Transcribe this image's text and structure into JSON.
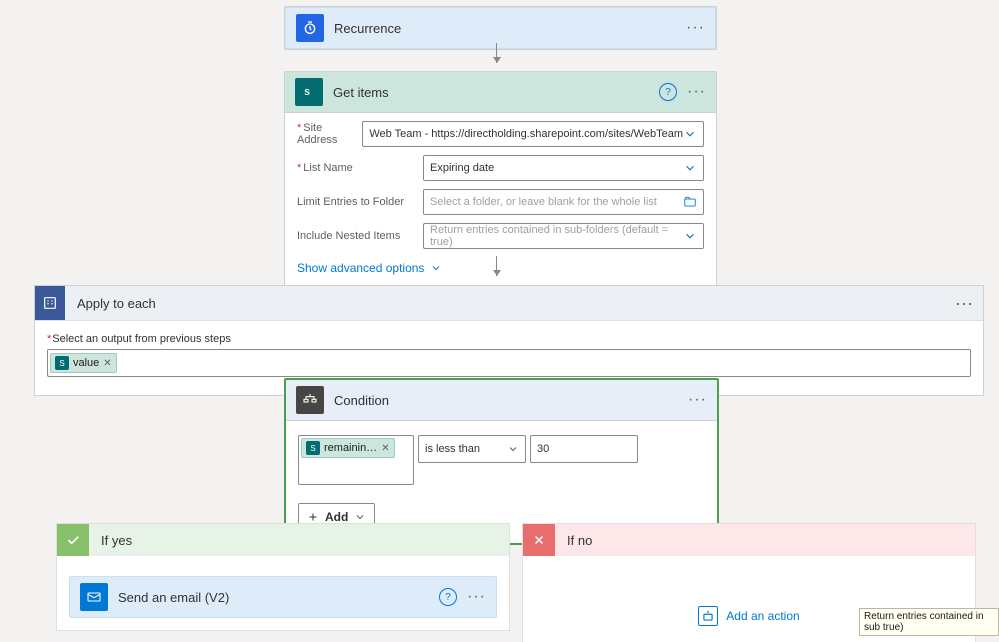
{
  "recurrence": {
    "title": "Recurrence"
  },
  "getItems": {
    "title": "Get items",
    "siteAddress": {
      "label": "Site Address",
      "value": "Web Team - https://directholding.sharepoint.com/sites/WebTeam"
    },
    "listName": {
      "label": "List Name",
      "value": "Expiring date"
    },
    "limitFolder": {
      "label": "Limit Entries to Folder",
      "placeholder": "Select a folder, or leave blank for the whole list"
    },
    "nested": {
      "label": "Include Nested Items",
      "placeholder": "Return entries contained in sub-folders (default = true)"
    },
    "advanced": "Show advanced options"
  },
  "applyToEach": {
    "title": "Apply to each",
    "outputLabel": "Select an output from previous steps",
    "token": "value"
  },
  "condition": {
    "title": "Condition",
    "leftToken": "remainin…",
    "operator": "is less than",
    "right": "30",
    "addLabel": "Add"
  },
  "ifYes": {
    "title": "If yes"
  },
  "ifNo": {
    "title": "If no",
    "addAction": "Add an action"
  },
  "email": {
    "title": "Send an email (V2)"
  },
  "tooltip": "Return entries contained in sub true)"
}
